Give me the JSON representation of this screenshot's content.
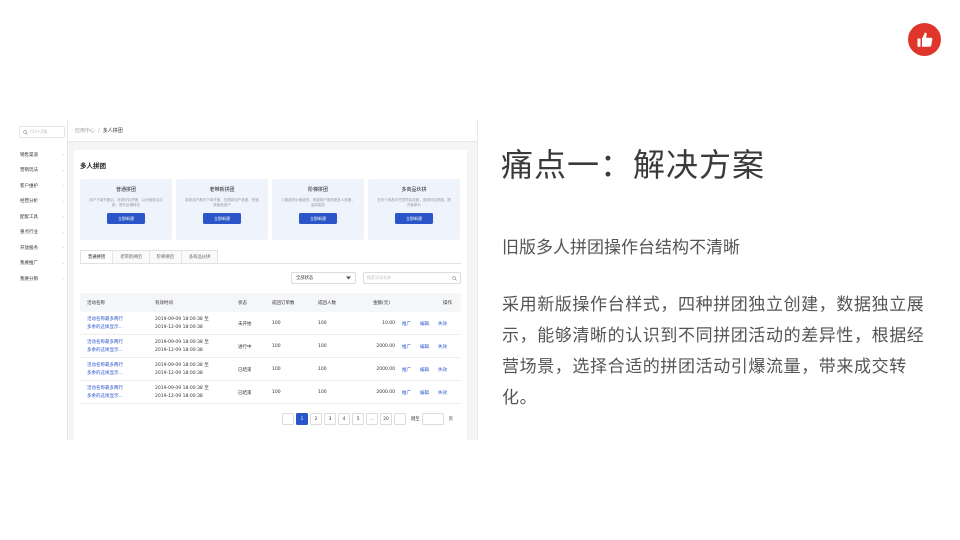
{
  "screenshot": {
    "sidebar": {
      "search_placeholder": "Ctrl+Z搜",
      "items": [
        "销售渠道",
        "营销玩法",
        "客户维护",
        "经营分析",
        "配套工具",
        "重点行业",
        "开放服务",
        "我要推广",
        "我要分销"
      ]
    },
    "breadcrumb": {
      "parent": "应用中心",
      "sep": "/",
      "current": "多人拼团"
    },
    "page_title": "多人拼团",
    "types": [
      {
        "name": "普通拼团",
        "desc": "用户下单开团后，邀请好友拼团，以优惠吸引拉新，提升店铺转化",
        "button": "立即新建"
      },
      {
        "name": "老带新拼团",
        "desc": "新老用户都可下单开团，仅限新用户参团，快速获取新用户",
        "button": "立即新建"
      },
      {
        "name": "阶梯拼团",
        "desc": "人数越多价格越低，刺激用户邀请更多人参团，高效裂变",
        "button": "立即新建"
      },
      {
        "name": "多商品伙拼",
        "desc": "在多个商品中任意购买成团，邀请好友拼团，提升客单价",
        "button": "立即新建"
      }
    ],
    "tabs": [
      "普通拼团",
      "老带新拼团",
      "阶梯拼团",
      "多商品伙拼"
    ],
    "status_filter": "全部状态",
    "search_placeholder": "搜索活动名称",
    "columns": {
      "name": "活动名称",
      "time": "有效时间",
      "status": "状态",
      "orders": "成团订单数",
      "people": "成团人数",
      "amount": "金额(元)",
      "ops": "操作"
    },
    "rows": [
      {
        "name1": "活动名称最多两行",
        "name2": "多余的这样显示...",
        "time1": "2019-09-09 18:00:38 至",
        "time2": "2019-12-09 18:00:38",
        "status": "未开始",
        "orders": "100",
        "people": "100",
        "amount": "10.00",
        "op1": "推广",
        "op2": "编辑",
        "op3": "失效"
      },
      {
        "name1": "活动名称最多两行",
        "name2": "多余的这样显示...",
        "time1": "2019-09-09 18:00:38 至",
        "time2": "2019-12-09 18:00:38",
        "status": "进行中",
        "orders": "100",
        "people": "100",
        "amount": "2000.00",
        "op1": "推广",
        "op2": "编辑",
        "op3": "失效"
      },
      {
        "name1": "活动名称最多两行",
        "name2": "多余的这样显示...",
        "time1": "2019-09-09 18:00:38 至",
        "time2": "2019-12-09 18:00:38",
        "status": "已结束",
        "orders": "100",
        "people": "100",
        "amount": "2000.00",
        "op1": "推广",
        "op2": "编辑",
        "op3": "失效"
      },
      {
        "name1": "活动名称最多两行",
        "name2": "多余的这样显示...",
        "time1": "2019-09-09 18:00:38 至",
        "time2": "2019-12-09 18:00:38",
        "status": "已结束",
        "orders": "100",
        "people": "100",
        "amount": "2000.00",
        "op1": "推广",
        "op2": "编辑",
        "op3": "失效"
      }
    ],
    "pager": {
      "prev": "‹",
      "pages": [
        "1",
        "2",
        "3",
        "4",
        "5",
        "...",
        "20"
      ],
      "next": "›",
      "goto": "跳至",
      "unit": "页"
    }
  },
  "slide": {
    "title": "痛点一：解决方案",
    "subtitle": "旧版多人拼团操作台结构不清晰",
    "body": "采用新版操作台样式，四种拼团独立创建，数据独立展示，能够清晰的认识到不同拼团活动的差异性，根据经营场景，选择合适的拼团活动引爆流量，带来成交转化。"
  },
  "colors": {
    "brand_red": "#e0352b",
    "primary_blue": "#2a56c9",
    "type_card_bg": "#eef3fc"
  },
  "icons": {
    "logo": "thumbs-up-icon",
    "search": "search-icon",
    "dropdown": "caret-down-icon",
    "chevron": "chevron-right-icon"
  }
}
